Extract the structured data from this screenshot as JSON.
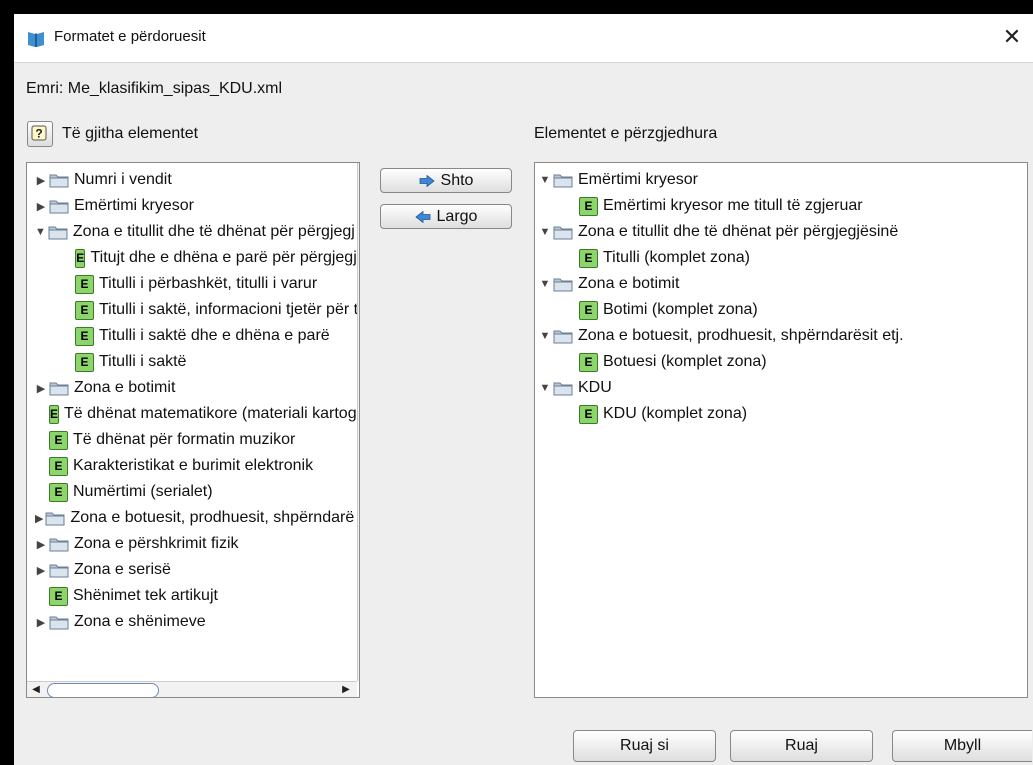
{
  "window": {
    "title": "Formatet e përdoruesit",
    "close_glyph": "✕",
    "app_icon": "book-icon"
  },
  "name_row": "Emri:  Me_klasifikim_sipas_KDU.xml",
  "left_label": "Të gjitha elementet",
  "right_label": "Elementet e përzgjedhura",
  "buttons": {
    "add": "Shto",
    "remove": "Largo",
    "save_as": "Ruaj si",
    "save": "Ruaj",
    "close": "Mbyll"
  },
  "left_tree": [
    {
      "type": "folder",
      "expand": "collapsed",
      "level": 0,
      "label": "Numri i vendit"
    },
    {
      "type": "folder",
      "expand": "collapsed",
      "level": 0,
      "label": "Emërtimi kryesor"
    },
    {
      "type": "folder",
      "expand": "expanded",
      "level": 0,
      "label": "Zona e titullit dhe të dhënat për përgjegjësinë"
    },
    {
      "type": "element",
      "level": 1,
      "label": "Titujt dhe e dhëna e parë për përgjegjësinë"
    },
    {
      "type": "element",
      "level": 1,
      "label": "Titulli i përbashkët, titulli i varur"
    },
    {
      "type": "element",
      "level": 1,
      "label": "Titulli i saktë, informacioni tjetër për titullin"
    },
    {
      "type": "element",
      "level": 1,
      "label": "Titulli i saktë dhe e dhëna e parë"
    },
    {
      "type": "element",
      "level": 1,
      "label": "Titulli i saktë"
    },
    {
      "type": "folder",
      "expand": "collapsed",
      "level": 0,
      "label": "Zona e botimit"
    },
    {
      "type": "element",
      "level": 0,
      "label": "Të dhënat matematikore (materiali kartografik)"
    },
    {
      "type": "element",
      "level": 0,
      "label": "Të dhënat për formatin muzikor"
    },
    {
      "type": "element",
      "level": 0,
      "label": "Karakteristikat e burimit elektronik"
    },
    {
      "type": "element",
      "level": 0,
      "label": "Numërtimi (serialet)"
    },
    {
      "type": "folder",
      "expand": "collapsed",
      "level": 0,
      "label": "Zona e botuesit, prodhuesit, shpërndarësit etj."
    },
    {
      "type": "folder",
      "expand": "collapsed",
      "level": 0,
      "label": "Zona e përshkrimit fizik"
    },
    {
      "type": "folder",
      "expand": "collapsed",
      "level": 0,
      "label": "Zona e serisë"
    },
    {
      "type": "element",
      "level": 0,
      "label": "Shënimet tek artikujt"
    },
    {
      "type": "folder",
      "expand": "collapsed",
      "level": 0,
      "label": "Zona e shënimeve"
    }
  ],
  "right_tree": [
    {
      "type": "folder",
      "expand": "expanded",
      "level": 0,
      "label": "Emërtimi kryesor"
    },
    {
      "type": "element",
      "level": 1,
      "label": "Emërtimi kryesor me titull të zgjeruar"
    },
    {
      "type": "folder",
      "expand": "expanded",
      "level": 0,
      "label": "Zona e titullit dhe të dhënat për përgjegjësinë"
    },
    {
      "type": "element",
      "level": 1,
      "label": "Titulli (komplet zona)"
    },
    {
      "type": "folder",
      "expand": "expanded",
      "level": 0,
      "label": "Zona e botimit"
    },
    {
      "type": "element",
      "level": 1,
      "label": "Botimi (komplet zona)"
    },
    {
      "type": "folder",
      "expand": "expanded",
      "level": 0,
      "label": "Zona e botuesit, prodhuesit, shpërndarësit etj."
    },
    {
      "type": "element",
      "level": 1,
      "label": "Botuesi (komplet zona)"
    },
    {
      "type": "folder",
      "expand": "expanded",
      "level": 0,
      "label": "KDU"
    },
    {
      "type": "element",
      "level": 1,
      "label": "KDU (komplet zona)"
    }
  ]
}
